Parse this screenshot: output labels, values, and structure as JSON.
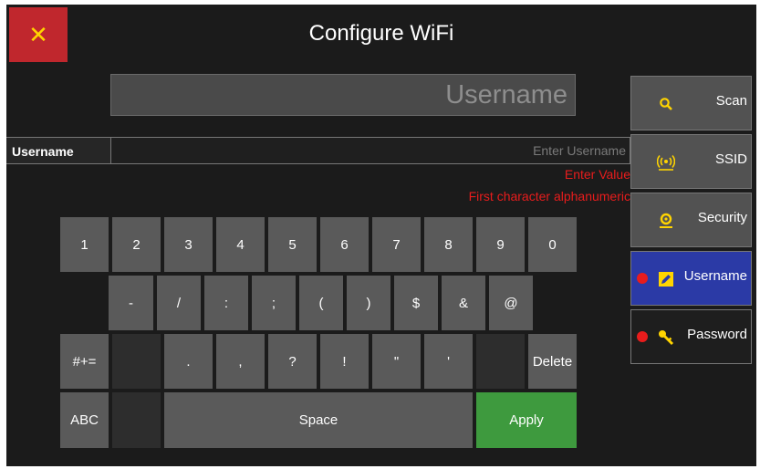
{
  "header": {
    "close_glyph": "✕",
    "title": "Configure WiFi"
  },
  "preview": {
    "text": "Username"
  },
  "field": {
    "label": "Username",
    "placeholder": "Enter Username"
  },
  "errors": {
    "line1": "Enter Value",
    "line2": "First character alphanumeric"
  },
  "keyboard": {
    "row1": [
      "1",
      "2",
      "3",
      "4",
      "5",
      "6",
      "7",
      "8",
      "9",
      "0"
    ],
    "row2": [
      "-",
      "/",
      ":",
      ";",
      "(",
      ")",
      "$",
      "&",
      "@"
    ],
    "row3": [
      ".",
      ",",
      "?",
      "!",
      "\"",
      "'"
    ],
    "toggle_symbols": "#+=",
    "delete": "Delete",
    "abc": "ABC",
    "space": "Space",
    "apply": "Apply"
  },
  "sidebar": {
    "items": [
      {
        "label": "Scan",
        "icon": "search-icon"
      },
      {
        "label": "SSID",
        "icon": "wifi-icon"
      },
      {
        "label": "Security",
        "icon": "security-icon"
      },
      {
        "label": "Username",
        "icon": "edit-icon"
      },
      {
        "label": "Password",
        "icon": "key-icon"
      }
    ]
  },
  "colors": {
    "accent_close": "#c0272d",
    "apply": "#3e9a3e",
    "active_tab": "#2b3aa6",
    "error": "#e81c1c",
    "icon": "#ffd400"
  }
}
